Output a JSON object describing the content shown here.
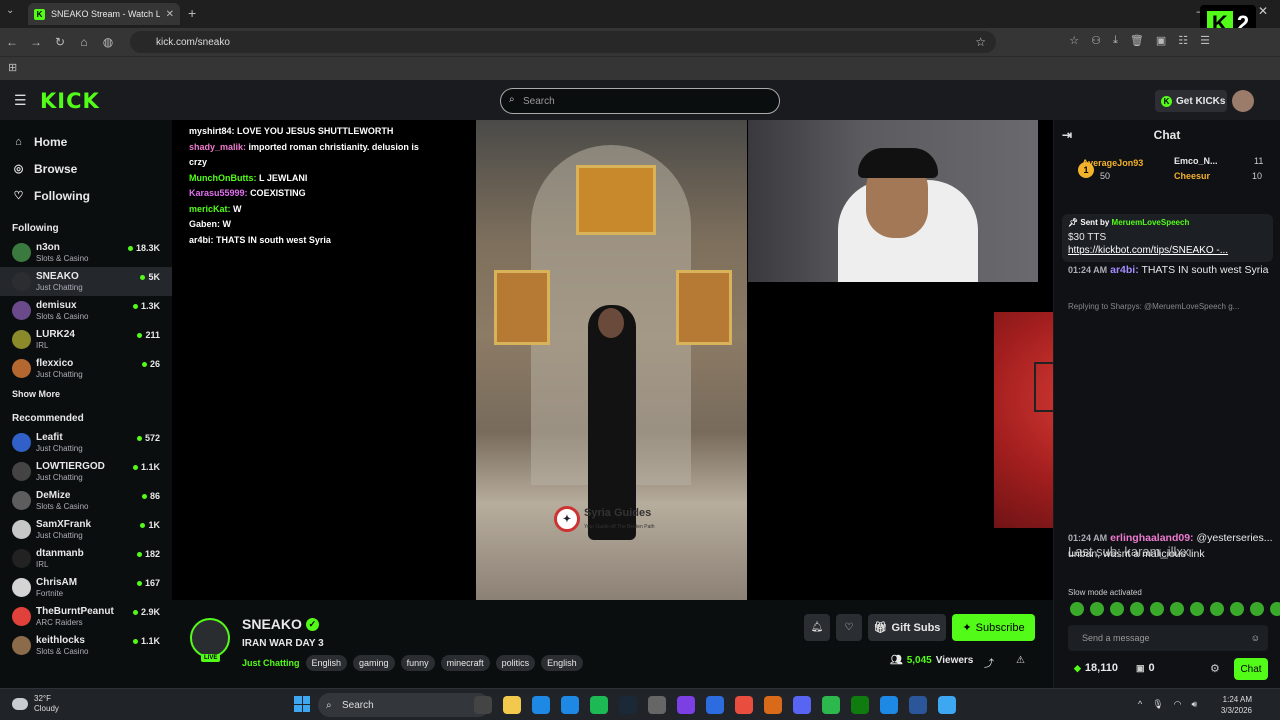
{
  "browser": {
    "tab_title": "SNEAKO Stream - Watch Li",
    "url": "kick.com/sneako"
  },
  "k2_badge": {
    "letter": "K",
    "number": "2"
  },
  "header": {
    "logo": "KICK",
    "search_placeholder": "Search",
    "get_kicks_label": "Get KICKs"
  },
  "sidebar": {
    "nav": [
      {
        "label": "Home",
        "icon": "home-icon"
      },
      {
        "label": "Browse",
        "icon": "compass-icon"
      },
      {
        "label": "Following",
        "icon": "heart-icon"
      }
    ],
    "following_header": "Following",
    "following": [
      {
        "name": "n3on",
        "category": "Slots & Casino",
        "viewers": "18.3K",
        "color": "#3b7a3f"
      },
      {
        "name": "SNEAKO",
        "category": "Just Chatting",
        "viewers": "5K",
        "color": "#2b2d30"
      },
      {
        "name": "demisux",
        "category": "Slots & Casino",
        "viewers": "1.3K",
        "color": "#6a4a8a"
      },
      {
        "name": "LURK24",
        "category": "IRL",
        "viewers": "211",
        "color": "#8a8a2a"
      },
      {
        "name": "flexxico",
        "category": "Just Chatting",
        "viewers": "26",
        "color": "#b4672f"
      }
    ],
    "show_more": "Show More",
    "recommended_header": "Recommended",
    "recommended": [
      {
        "name": "Leafit",
        "category": "Just Chatting",
        "viewers": "572",
        "color": "#3060c8"
      },
      {
        "name": "LOWTIERGOD",
        "category": "Just Chatting",
        "viewers": "1.1K",
        "color": "#444"
      },
      {
        "name": "DeMize",
        "category": "Slots & Casino",
        "viewers": "86",
        "color": "#5d5d5d"
      },
      {
        "name": "SamXFrank",
        "category": "Just Chatting",
        "viewers": "1K",
        "color": "#c7c7c7"
      },
      {
        "name": "dtanmanb",
        "category": "IRL",
        "viewers": "182",
        "color": "#222"
      },
      {
        "name": "ChrisAM",
        "category": "Fortnite",
        "viewers": "167",
        "color": "#d4d4d4"
      },
      {
        "name": "TheBurntPeanut",
        "category": "ARC Raiders",
        "viewers": "2.9K",
        "color": "#e0413a"
      },
      {
        "name": "keithlocks",
        "category": "Slots & Casino",
        "viewers": "1.1K",
        "color": "#8c6b4a"
      }
    ]
  },
  "video_overlay_chat": [
    {
      "user": "myshirt84:",
      "user_color": "#ffffff",
      "text": "LOVE YOU JESUS SHUTTLEWORTH"
    },
    {
      "user": "shady_malik:",
      "user_color": "#f07ad0",
      "text": "imported roman christianity. delusion is crzy"
    },
    {
      "user": "MunchOnButts:",
      "user_color": "#53fc18",
      "text": "L JEWLANI"
    },
    {
      "user": "Karasu55999:",
      "user_color": "#e36ff0",
      "text": "COEXISTING"
    },
    {
      "user": "mericKat:",
      "user_color": "#53fc18",
      "text": "W"
    },
    {
      "user": "Gaben:",
      "user_color": "#ffffff",
      "text": "W"
    },
    {
      "user": "ar4bi:",
      "user_color": "#ffffff",
      "text": "THATS IN south west Syria"
    }
  ],
  "video": {
    "watermark": "Syria Guides",
    "watermark_sub": "Your Guide off The Beaten Path"
  },
  "stream": {
    "streamer": "SNEAKO",
    "live_label": "LIVE",
    "title": "IRAN WAR DAY 3",
    "category": "Just Chatting",
    "tags": [
      "English",
      "gaming",
      "funny",
      "minecraft",
      "politics",
      "English"
    ],
    "gift_subs_label": "Gift Subs",
    "subscribe_label": "Subscribe",
    "viewers_count": "5,045",
    "viewers_label": "Viewers"
  },
  "chat": {
    "title": "Chat",
    "gifters": {
      "top_rank": "1",
      "top_name": "AverageJon93",
      "top_count": "50",
      "second_name": "Emco_N...",
      "second_count": "11",
      "third_name": "Cheesur",
      "third_count": "10"
    },
    "pinned": {
      "sent_by_label": "Sent by",
      "sender": "MeruemLoveSpeech",
      "tts": "$30 TTS",
      "link": "https://kickbot.com/tips/SNEAKO -..."
    },
    "messages": [
      {
        "time": "01:24 AM",
        "user": "ar4bi:",
        "text": "THATS IN south west Syria"
      },
      {
        "time": "01:24 AM",
        "user": "erlinghaaland09:",
        "text": "@yesterseries... unban, wasnt a malicious link"
      }
    ],
    "reply_label": "Replying to Sharpys: @MeruemLoveSpeech g...",
    "overlay_text": "Last sub: karam_illxx",
    "slow_mode": "Slow mode activated",
    "input_placeholder": "Send a message",
    "kicks_balance": "18,110",
    "second_balance": "0",
    "chat_button": "Chat"
  },
  "taskbar": {
    "weather_temp": "32°F",
    "weather_desc": "Cloudy",
    "search_label": "Search",
    "time": "1:24 AM",
    "date": "3/3/2026"
  }
}
